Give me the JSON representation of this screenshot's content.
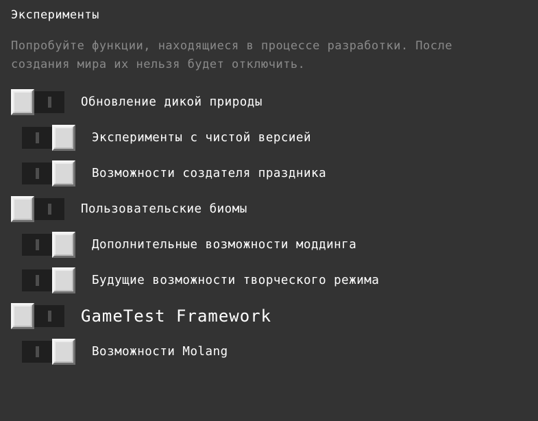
{
  "section": {
    "title": "Эксперименты",
    "description": "Попробуйте функции, находящиеся в процессе разработки. После создания мира их нельзя будет отключить."
  },
  "options": [
    {
      "label": "Обновление дикой природы",
      "state": "off",
      "indented": false,
      "big": false
    },
    {
      "label": "Эксперименты с чистой версией",
      "state": "on",
      "indented": true,
      "big": false
    },
    {
      "label": "Возможности создателя праздника",
      "state": "on",
      "indented": true,
      "big": false
    },
    {
      "label": "Пользовательские биомы",
      "state": "off",
      "indented": false,
      "big": false
    },
    {
      "label": "Дополнительные возможности моддинга",
      "state": "on",
      "indented": true,
      "big": false
    },
    {
      "label": "Будущие возможности творческого режима",
      "state": "on",
      "indented": true,
      "big": false
    },
    {
      "label": "GameTest Framework",
      "state": "off",
      "indented": false,
      "big": true
    },
    {
      "label": "Возможности Molang",
      "state": "on",
      "indented": true,
      "big": false
    }
  ]
}
